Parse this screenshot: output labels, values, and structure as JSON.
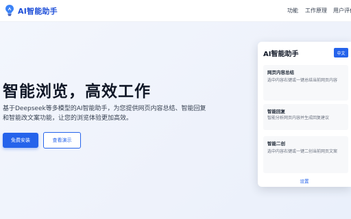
{
  "header": {
    "logo_icon": "lightbulb-icon",
    "title": "AI智能助手",
    "nav": [
      "功能",
      "工作原理",
      "用户评价"
    ]
  },
  "hero": {
    "title": "智能浏览，高效工作",
    "description": "基于Deepseek等多模型的AI智能助手，为您提供网页内容总结、智能回复和智能改文案功能，让您的浏览体验更加高效。",
    "primary_button": "免费安装",
    "secondary_button": "查看演示"
  },
  "panel": {
    "title": "AI智能助手",
    "language": "中文",
    "cards": [
      {
        "title": "网页内容总结",
        "desc": "选中内容右键或一键总结当前网页内容"
      },
      {
        "title": "智能回复",
        "desc": "智能分析网页内容并生成回复建议"
      },
      {
        "title": "智能二创",
        "desc": "选中内容右键或一键二创当前网页文案"
      }
    ],
    "settings": "设置"
  },
  "colors": {
    "accent": "#2563eb",
    "brand_text": "#1d4ed8",
    "hero_bg": "#f1f5fd"
  }
}
